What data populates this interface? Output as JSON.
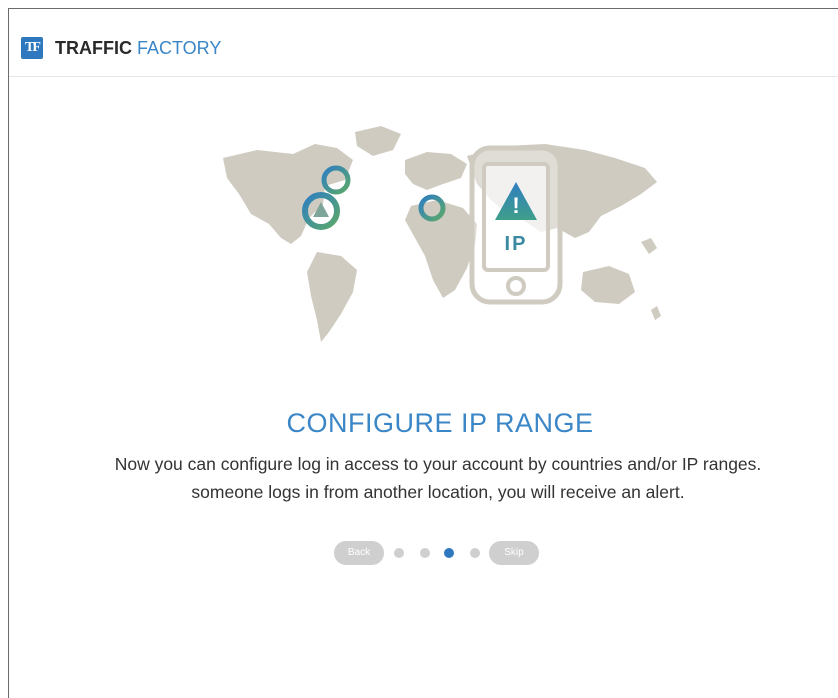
{
  "brand": {
    "logo_text": "TF",
    "name_bold": "TRAFFIC",
    "name_light": "FACTORY",
    "accent": "#3b86c6"
  },
  "illustration": {
    "alert_glyph": "!",
    "phone_label": "IP"
  },
  "slide": {
    "title": "CONFIGURE IP RANGE",
    "lines": [
      "Now you can configure log in access to your account by countries and/or IP ranges.",
      "someone logs in from another location, you will receive an alert."
    ]
  },
  "pager": {
    "back_label": "Back",
    "skip_label": "Skip",
    "total_steps": 4,
    "active_step": 3
  }
}
